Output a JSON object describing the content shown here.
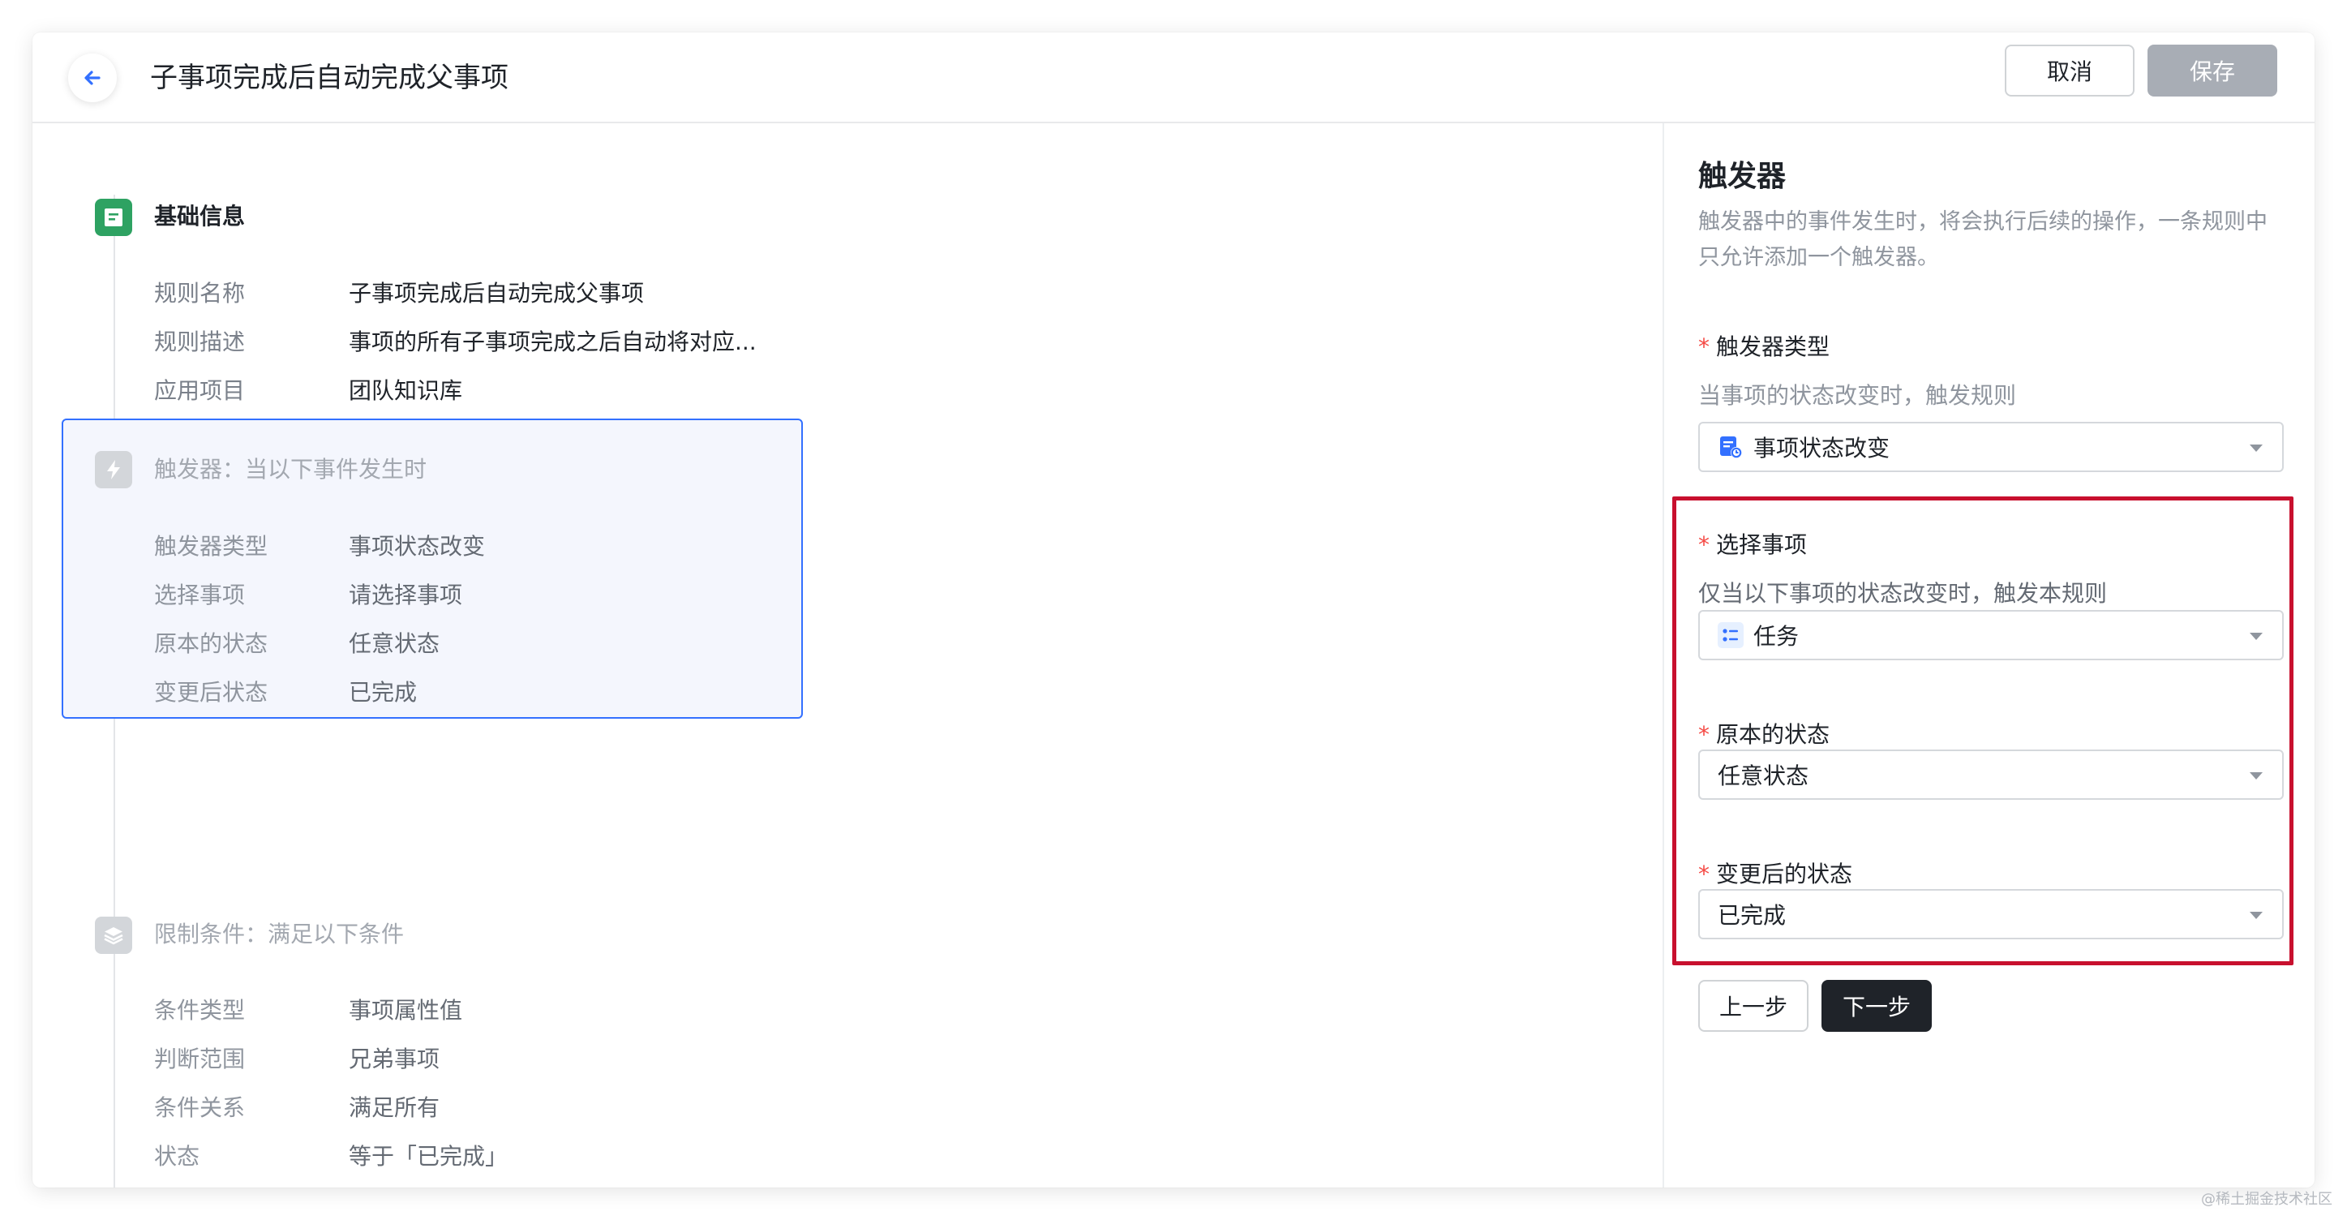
{
  "header": {
    "title": "子事项完成后自动完成父事项",
    "cancel_label": "取消",
    "save_label": "保存"
  },
  "flow": {
    "basic": {
      "title": "基础信息",
      "rows": [
        {
          "label": "规则名称",
          "value": "子事项完成后自动完成父事项"
        },
        {
          "label": "规则描述",
          "value": "事项的所有子事项完成之后自动将对应..."
        },
        {
          "label": "应用项目",
          "value": "团队知识库"
        }
      ]
    },
    "trigger": {
      "title": "触发器：当以下事件发生时",
      "rows": [
        {
          "label": "触发器类型",
          "value": "事项状态改变"
        },
        {
          "label": "选择事项",
          "value": "请选择事项"
        },
        {
          "label": "原本的状态",
          "value": "任意状态"
        },
        {
          "label": "变更后状态",
          "value": "已完成"
        }
      ]
    },
    "limit": {
      "title": "限制条件：满足以下条件",
      "rows": [
        {
          "label": "条件类型",
          "value": "事项属性值"
        },
        {
          "label": "判断范围",
          "value": "兄弟事项"
        },
        {
          "label": "条件关系",
          "value": "满足所有"
        },
        {
          "label": "状态",
          "value": "等于「已完成」"
        }
      ]
    }
  },
  "panel": {
    "title": "触发器",
    "description": "触发器中的事件发生时，将会执行后续的操作，一条规则中只允许添加一个触发器。",
    "required_mark": "*",
    "trigger_type": {
      "label": "触发器类型",
      "hint": "当事项的状态改变时，触发规则",
      "value": "事项状态改变"
    },
    "select_item": {
      "label": "选择事项",
      "hint": "仅当以下事项的状态改变时，触发本规则",
      "value": "任务"
    },
    "from_status": {
      "label": "原本的状态",
      "value": "任意状态"
    },
    "to_status": {
      "label": "变更后的状态",
      "value": "已完成"
    },
    "prev_label": "上一步",
    "next_label": "下一步"
  },
  "watermark": "@稀土掘金技术社区",
  "colors": {
    "accent": "#3370ff",
    "success": "#2ea262",
    "highlight": "#c8102e",
    "required": "#f54a45"
  }
}
